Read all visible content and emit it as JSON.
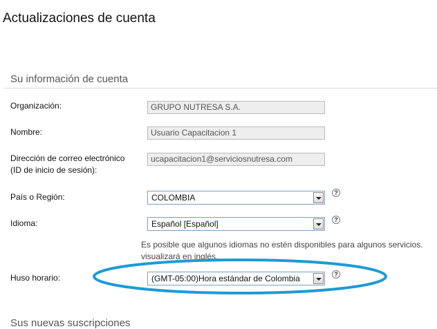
{
  "page": {
    "title": "Actualizaciones de cuenta"
  },
  "account_section": {
    "title": "Su información de cuenta",
    "organization": {
      "label": "Organización:",
      "value": "GRUPO NUTRESA S.A."
    },
    "name": {
      "label": "Nombre:",
      "value": "Usuario Capacitacion 1"
    },
    "email": {
      "label_line1": "Dirección de correo electrónico",
      "label_line2": "(ID de inicio de sesión):",
      "value": "ucapacitacion1@serviciosnutresa.com"
    },
    "country": {
      "label": "País o Región:",
      "selected": "COLOMBIA"
    },
    "language": {
      "label": "Idioma:",
      "selected": "Español [Español]",
      "note_line1": "Es posible que algunos idiomas no estén disponibles para algunos servicios.",
      "note_line2": "visualizará en inglés."
    },
    "timezone": {
      "label": "Huso horario:",
      "selected": "(GMT-05:00)Hora estándar de Colombia"
    },
    "help_glyph": "?"
  },
  "subscriptions_section": {
    "title": "Sus nuevas suscripciones"
  },
  "colors": {
    "annotation_ellipse": "#1e9ad6",
    "field_readonly_bg": "#eeeeee"
  }
}
